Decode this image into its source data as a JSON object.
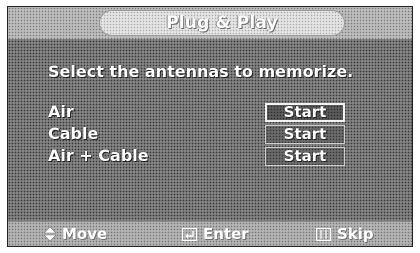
{
  "window": {
    "title": "Plug & Play"
  },
  "content": {
    "instruction": "Select the antennas to memorize.",
    "options": [
      {
        "label": "Air",
        "button_label": "Start",
        "selected": true
      },
      {
        "label": "Cable",
        "button_label": "Start",
        "selected": false
      },
      {
        "label": "Air + Cable",
        "button_label": "Start",
        "selected": false
      }
    ]
  },
  "footer": {
    "hints": [
      {
        "icon": "up-down-arrows-icon",
        "label": "Move"
      },
      {
        "icon": "enter-icon",
        "label": "Enter"
      },
      {
        "icon": "skip-icon",
        "label": "Skip"
      }
    ]
  },
  "colors": {
    "background": "#7a7a7a",
    "titlebar": "#bcbcbc",
    "text": "#ffffff"
  }
}
